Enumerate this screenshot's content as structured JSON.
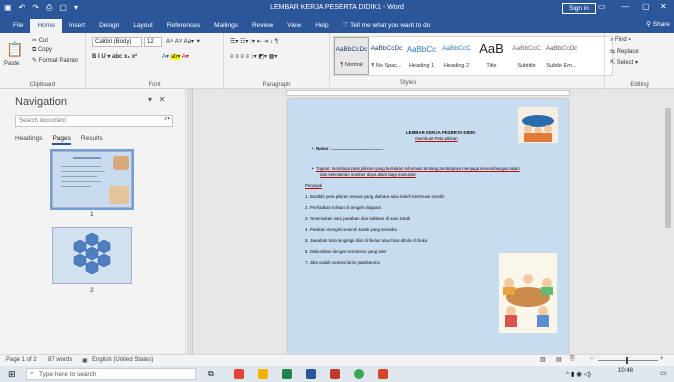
{
  "titlebar": {
    "title": "LEMBAR KERJA PESERTA DIDIK1 - Word",
    "signin": "Sign in"
  },
  "tabs": [
    "File",
    "Home",
    "Insert",
    "Design",
    "Layout",
    "References",
    "Mailings",
    "Review",
    "View",
    "Help",
    "Tell me what you want to do"
  ],
  "share": "Share",
  "ribbon": {
    "clipboard": {
      "paste": "Paste",
      "cut": "Cut",
      "copy": "Copy",
      "format_painter": "Format Painter",
      "label": "Clipboard"
    },
    "font": {
      "name": "Calibri (Body)",
      "size": "12",
      "label": "Font"
    },
    "paragraph": {
      "label": "Paragraph"
    },
    "styles": {
      "label": "Styles",
      "items": [
        {
          "preview": "AaBbCcDc",
          "name": "¶ Normal"
        },
        {
          "preview": "AaBbCcDc",
          "name": "¶ No Spac..."
        },
        {
          "preview": "AaBbCc",
          "name": "Heading 1"
        },
        {
          "preview": "AaBbCcC",
          "name": "Heading 2"
        },
        {
          "preview": "AaB",
          "name": "Title"
        },
        {
          "preview": "AaBbCcC",
          "name": "Subtitle"
        },
        {
          "preview": "AaBbCcDc",
          "name": "Subtle Em..."
        }
      ]
    },
    "editing": {
      "find": "Find",
      "replace": "Replace",
      "select": "Select",
      "label": "Editing"
    }
  },
  "navigation": {
    "title": "Navigation",
    "search_placeholder": "Search document",
    "tabs": [
      "Headings",
      "Pages",
      "Results"
    ],
    "page1": "1",
    "page2": "2"
  },
  "document": {
    "header_line1": "LEMBAR KERJA PESERTA DIDIK",
    "header_line2": "membuat Peta pikiran",
    "nama": "Nama : ..........................................",
    "tujuan1": "Tujuan: membuat peta pikiran yang berisikan informasi tentang pentingnya menjaga keseimbangan alam",
    "tujuan2": "dan kelestarian sumber daya alam bagi manusia!",
    "petunjuk": "Petunjuk",
    "steps": [
      "1. Buatlah peta pikiran sesuai yang diahara atau boleh berkreasi sendiri",
      "2. Perhatikan tulisan di tengah diagram.",
      "3. Tenemukan satu jawaban dan tuliskan di satu kotak",
      "4. Pasikan mengisi seluruh kotak yang tersedia.",
      "5. Jawaban bisa lengkapi diisi di filetas atau bisa ditulis di buku",
      "6. Diskusikan dengan temanmu yang lain!",
      "7. Jika sudah selesai kirim jawabanmu"
    ]
  },
  "statusbar": {
    "page": "Page 1 of 2",
    "words": "87 words",
    "language": "English (United States)"
  },
  "taskbar": {
    "search_placeholder": "Type here to search",
    "time": "10:48"
  }
}
